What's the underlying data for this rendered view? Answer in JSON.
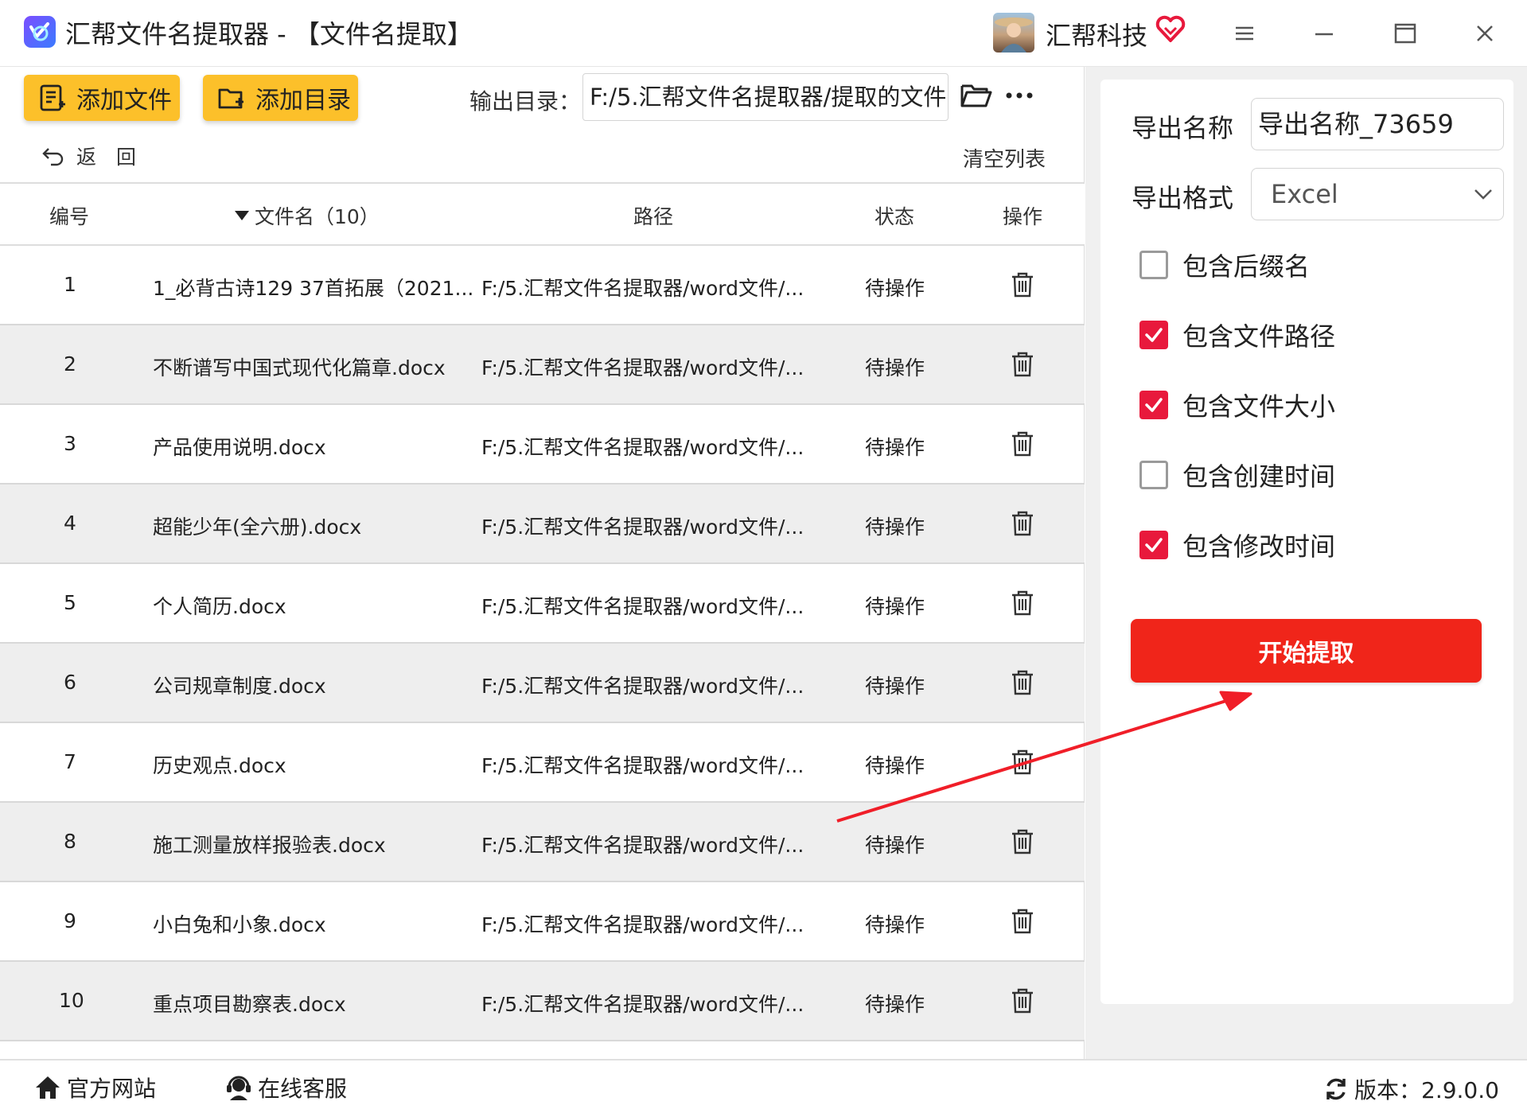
{
  "window": {
    "title": "汇帮文件名提取器 - 【文件名提取】",
    "company": "汇帮科技"
  },
  "toolbar": {
    "add_file_label": "添加文件",
    "add_dir_label": "添加目录",
    "output_label": "输出目录：",
    "output_value": "F:/5.汇帮文件名提取器/提取的文件",
    "back_label": "返　回",
    "clear_label": "清空列表"
  },
  "table": {
    "headers": {
      "index": "编号",
      "filename": "文件名（10）",
      "path": "路径",
      "status": "状态",
      "action": "操作"
    },
    "rows": [
      {
        "index": "1",
        "name": "1_必背古诗129 37首拓展（2021...",
        "path": "F:/5.汇帮文件名提取器/word文件/...",
        "status": "待操作"
      },
      {
        "index": "2",
        "name": "不断谱写中国式现代化篇章.docx",
        "path": "F:/5.汇帮文件名提取器/word文件/...",
        "status": "待操作"
      },
      {
        "index": "3",
        "name": "产品使用说明.docx",
        "path": "F:/5.汇帮文件名提取器/word文件/...",
        "status": "待操作"
      },
      {
        "index": "4",
        "name": "超能少年(全六册).docx",
        "path": "F:/5.汇帮文件名提取器/word文件/...",
        "status": "待操作"
      },
      {
        "index": "5",
        "name": "个人简历.docx",
        "path": "F:/5.汇帮文件名提取器/word文件/...",
        "status": "待操作"
      },
      {
        "index": "6",
        "name": "公司规章制度.docx",
        "path": "F:/5.汇帮文件名提取器/word文件/...",
        "status": "待操作"
      },
      {
        "index": "7",
        "name": "历史观点.docx",
        "path": "F:/5.汇帮文件名提取器/word文件/...",
        "status": "待操作"
      },
      {
        "index": "8",
        "name": "施工测量放样报验表.docx",
        "path": "F:/5.汇帮文件名提取器/word文件/...",
        "status": "待操作"
      },
      {
        "index": "9",
        "name": "小白兔和小象.docx",
        "path": "F:/5.汇帮文件名提取器/word文件/...",
        "status": "待操作"
      },
      {
        "index": "10",
        "name": "重点项目勘察表.docx",
        "path": "F:/5.汇帮文件名提取器/word文件/...",
        "status": "待操作"
      }
    ]
  },
  "settings": {
    "export_name_label": "导出名称",
    "export_name_value": "导出名称_73659",
    "export_format_label": "导出格式",
    "export_format_value": "Excel",
    "options": [
      {
        "label": "包含后缀名",
        "checked": false
      },
      {
        "label": "包含文件路径",
        "checked": true
      },
      {
        "label": "包含文件大小",
        "checked": true
      },
      {
        "label": "包含创建时间",
        "checked": false
      },
      {
        "label": "包含修改时间",
        "checked": true
      }
    ],
    "start_label": "开始提取"
  },
  "footer": {
    "website_label": "官方网站",
    "service_label": "在线客服",
    "version_label": "版本：2.9.0.0"
  },
  "colors": {
    "accent_yellow": "#fcc02a",
    "start_red": "#f0251a",
    "checkbox_red": "#e8193c",
    "arrow_red": "#f01e28"
  },
  "icons": [
    "app-logo-icon",
    "vip-heart-icon",
    "menu-icon",
    "minimize-icon",
    "maximize-icon",
    "close-icon",
    "add-file-icon",
    "add-folder-icon",
    "folder-open-icon",
    "more-icon",
    "back-arrow-icon",
    "sort-down-icon",
    "trash-icon",
    "chevron-down-icon",
    "checkmark-icon",
    "home-icon",
    "headset-icon",
    "refresh-icon"
  ]
}
